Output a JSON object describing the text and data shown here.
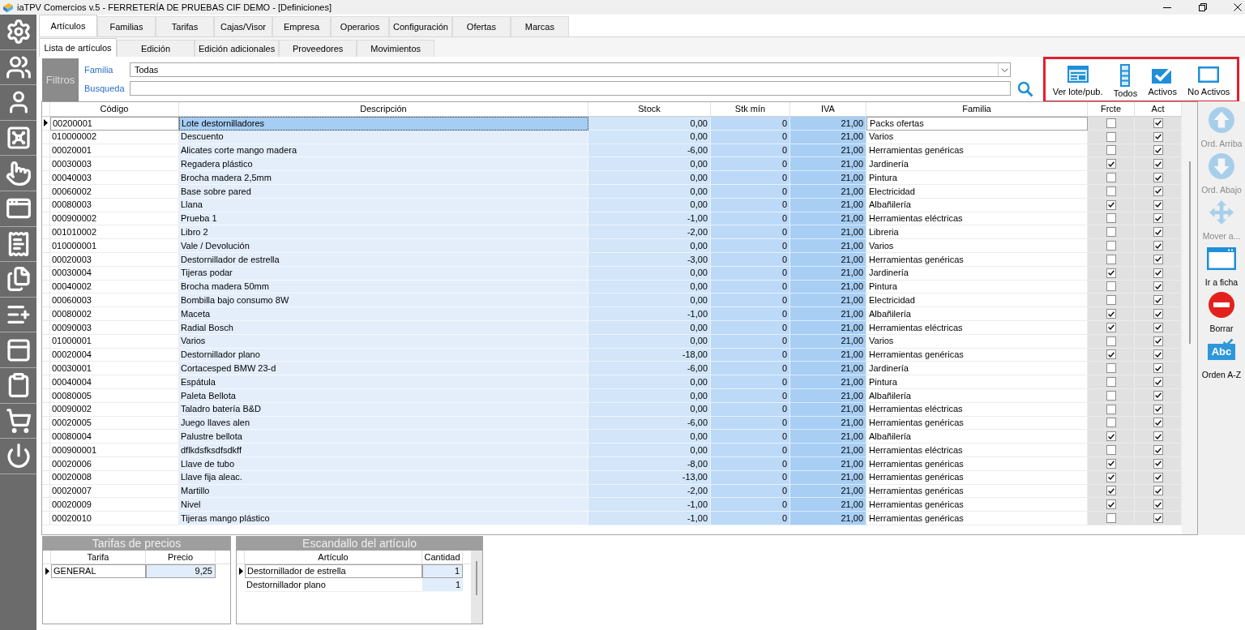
{
  "window": {
    "title": "iaTPV Comercios v.5 - FERRETERÍA DE PRUEBAS CIF DEMO - [Definiciones]"
  },
  "tabs": [
    {
      "label": "Artículos",
      "selected": true
    },
    {
      "label": "Familias",
      "selected": false
    },
    {
      "label": "Tarifas",
      "selected": false
    },
    {
      "label": "Cajas/Visor",
      "selected": false
    },
    {
      "label": "Empresa",
      "selected": false
    },
    {
      "label": "Operarios",
      "selected": false
    },
    {
      "label": "Configuración",
      "selected": false
    },
    {
      "label": "Ofertas",
      "selected": false
    },
    {
      "label": "Marcas",
      "selected": false
    }
  ],
  "subtabs": [
    {
      "label": "Lista de artículos",
      "selected": true
    },
    {
      "label": "Edición",
      "selected": false
    },
    {
      "label": "Edición adicionales",
      "selected": false
    },
    {
      "label": "Proveedores",
      "selected": false
    },
    {
      "label": "Movimientos",
      "selected": false
    }
  ],
  "filters": {
    "title": "Filtros",
    "familia": {
      "label": "Familia",
      "value": "Todas"
    },
    "busqueda": {
      "label": "Busqueda"
    }
  },
  "toolbar": [
    {
      "label": "Ver lote/pub."
    },
    {
      "label": "Todos"
    },
    {
      "label": "Activos"
    },
    {
      "label": "No Activos"
    }
  ],
  "table": {
    "columns": [
      "Código",
      "Descripción",
      "Stock",
      "Stk mín",
      "IVA",
      "Familia",
      "Frcte",
      "Act"
    ],
    "rows": [
      {
        "code": "00200001",
        "description": "Lote destornilladores",
        "stock": "0,00",
        "stk_min": "0",
        "iva": "21,00",
        "family": "Packs ofertas",
        "frcte": false,
        "act": true,
        "selected": true
      },
      {
        "code": "010000002",
        "description": "Descuento",
        "stock": "0,00",
        "stk_min": "0",
        "iva": "21,00",
        "family": "Varios",
        "frcte": false,
        "act": true,
        "selected": false
      },
      {
        "code": "00020001",
        "description": "Alicates corte mango madera",
        "stock": "-6,00",
        "stk_min": "0",
        "iva": "21,00",
        "family": "Herramientas genéricas",
        "frcte": false,
        "act": true,
        "selected": false
      },
      {
        "code": "00030003",
        "description": "Regadera plástico",
        "stock": "0,00",
        "stk_min": "0",
        "iva": "21,00",
        "family": "Jardinería",
        "frcte": true,
        "act": true,
        "selected": false
      },
      {
        "code": "00040003",
        "description": "Brocha madera 2,5mm",
        "stock": "0,00",
        "stk_min": "0",
        "iva": "21,00",
        "family": "Pintura",
        "frcte": false,
        "act": true,
        "selected": false
      },
      {
        "code": "00060002",
        "description": "Base sobre pared",
        "stock": "0,00",
        "stk_min": "0",
        "iva": "21,00",
        "family": "Electricidad",
        "frcte": false,
        "act": true,
        "selected": false
      },
      {
        "code": "00080003",
        "description": "Llana",
        "stock": "0,00",
        "stk_min": "0",
        "iva": "21,00",
        "family": "Albañilería",
        "frcte": true,
        "act": true,
        "selected": false
      },
      {
        "code": "000900002",
        "description": "Prueba 1",
        "stock": "-1,00",
        "stk_min": "0",
        "iva": "21,00",
        "family": "Herramientas eléctricas",
        "frcte": false,
        "act": true,
        "selected": false
      },
      {
        "code": "001010002",
        "description": "Libro 2",
        "stock": "-2,00",
        "stk_min": "0",
        "iva": "21,00",
        "family": "Libreria",
        "frcte": false,
        "act": true,
        "selected": false
      },
      {
        "code": "010000001",
        "description": "Vale / Devolución",
        "stock": "0,00",
        "stk_min": "0",
        "iva": "21,00",
        "family": "Varios",
        "frcte": false,
        "act": true,
        "selected": false
      },
      {
        "code": "00020003",
        "description": "Destornillador de estrella",
        "stock": "-3,00",
        "stk_min": "0",
        "iva": "21,00",
        "family": "Herramientas genéricas",
        "frcte": false,
        "act": true,
        "selected": false
      },
      {
        "code": "00030004",
        "description": "Tijeras podar",
        "stock": "0,00",
        "stk_min": "0",
        "iva": "21,00",
        "family": "Jardinería",
        "frcte": true,
        "act": true,
        "selected": false
      },
      {
        "code": "00040002",
        "description": "Brocha madera 50mm",
        "stock": "0,00",
        "stk_min": "0",
        "iva": "21,00",
        "family": "Pintura",
        "frcte": false,
        "act": true,
        "selected": false
      },
      {
        "code": "00060003",
        "description": "Bombilla bajo consumo 8W",
        "stock": "0,00",
        "stk_min": "0",
        "iva": "21,00",
        "family": "Electricidad",
        "frcte": false,
        "act": true,
        "selected": false
      },
      {
        "code": "00080002",
        "description": "Maceta",
        "stock": "-1,00",
        "stk_min": "0",
        "iva": "21,00",
        "family": "Albañilería",
        "frcte": true,
        "act": true,
        "selected": false
      },
      {
        "code": "00090003",
        "description": "Radial Bosch",
        "stock": "0,00",
        "stk_min": "0",
        "iva": "21,00",
        "family": "Herramientas eléctricas",
        "frcte": true,
        "act": true,
        "selected": false
      },
      {
        "code": "01000001",
        "description": "Varios",
        "stock": "0,00",
        "stk_min": "0",
        "iva": "21,00",
        "family": "Varios",
        "frcte": false,
        "act": true,
        "selected": false
      },
      {
        "code": "00020004",
        "description": "Destornillador plano",
        "stock": "-18,00",
        "stk_min": "0",
        "iva": "21,00",
        "family": "Herramientas genéricas",
        "frcte": true,
        "act": true,
        "selected": false
      },
      {
        "code": "00030001",
        "description": "Cortacesped BMW 23-d",
        "stock": "-6,00",
        "stk_min": "0",
        "iva": "21,00",
        "family": "Jardinería",
        "frcte": false,
        "act": true,
        "selected": false
      },
      {
        "code": "00040004",
        "description": "Espátula",
        "stock": "0,00",
        "stk_min": "0",
        "iva": "21,00",
        "family": "Pintura",
        "frcte": false,
        "act": true,
        "selected": false
      },
      {
        "code": "00080005",
        "description": "Paleta Bellota",
        "stock": "0,00",
        "stk_min": "0",
        "iva": "21,00",
        "family": "Albañilería",
        "frcte": false,
        "act": true,
        "selected": false
      },
      {
        "code": "00090002",
        "description": "Taladro batería B&D",
        "stock": "0,00",
        "stk_min": "0",
        "iva": "21,00",
        "family": "Herramientas eléctricas",
        "frcte": false,
        "act": true,
        "selected": false
      },
      {
        "code": "00020005",
        "description": "Juego llaves alen",
        "stock": "-6,00",
        "stk_min": "0",
        "iva": "21,00",
        "family": "Herramientas genéricas",
        "frcte": false,
        "act": true,
        "selected": false
      },
      {
        "code": "00080004",
        "description": "Palustre bellota",
        "stock": "0,00",
        "stk_min": "0",
        "iva": "21,00",
        "family": "Albañilería",
        "frcte": true,
        "act": true,
        "selected": false
      },
      {
        "code": "000900001",
        "description": "dflkdsfksdfsdkff",
        "stock": "0,00",
        "stk_min": "0",
        "iva": "21,00",
        "family": "Herramientas eléctricas",
        "frcte": false,
        "act": true,
        "selected": false
      },
      {
        "code": "00020006",
        "description": "Llave de tubo",
        "stock": "-8,00",
        "stk_min": "0",
        "iva": "21,00",
        "family": "Herramientas genéricas",
        "frcte": true,
        "act": true,
        "selected": false
      },
      {
        "code": "00020008",
        "description": "Llave fija aleac.",
        "stock": "-13,00",
        "stk_min": "0",
        "iva": "21,00",
        "family": "Herramientas genéricas",
        "frcte": true,
        "act": true,
        "selected": false
      },
      {
        "code": "00020007",
        "description": "Martillo",
        "stock": "-2,00",
        "stk_min": "0",
        "iva": "21,00",
        "family": "Herramientas genéricas",
        "frcte": true,
        "act": true,
        "selected": false
      },
      {
        "code": "00020009",
        "description": "Nivel",
        "stock": "-1,00",
        "stk_min": "0",
        "iva": "21,00",
        "family": "Herramientas genéricas",
        "frcte": true,
        "act": true,
        "selected": false
      },
      {
        "code": "00020010",
        "description": "Tijeras mango plástico",
        "stock": "-1,00",
        "stk_min": "0",
        "iva": "21,00",
        "family": "Herramientas genéricas",
        "frcte": false,
        "act": true,
        "selected": false
      }
    ]
  },
  "side_buttons": [
    {
      "label": "Ord. Arriba",
      "disabled": true
    },
    {
      "label": "Ord. Abajo",
      "disabled": true
    },
    {
      "label": "Mover a...",
      "disabled": true
    },
    {
      "label": "Ir a ficha",
      "disabled": false
    },
    {
      "label": "Borrar",
      "disabled": false
    },
    {
      "label": "Orden A-Z",
      "disabled": false,
      "icon_text": "Abc"
    }
  ],
  "price_rates": {
    "title": "Tarifas de precios",
    "columns": [
      "Tarifa",
      "Precio"
    ],
    "rows": [
      {
        "rate": "GENERAL",
        "price": "9,25",
        "selected": true
      }
    ]
  },
  "breakdown": {
    "title": "Escandallo del artículo",
    "columns": [
      "Artículo",
      "Cantidad"
    ],
    "rows": [
      {
        "article": "Destornillador de estrella",
        "quantity": "1",
        "selected": true
      },
      {
        "article": "Destornillador plano",
        "quantity": "1",
        "selected": false
      }
    ]
  }
}
